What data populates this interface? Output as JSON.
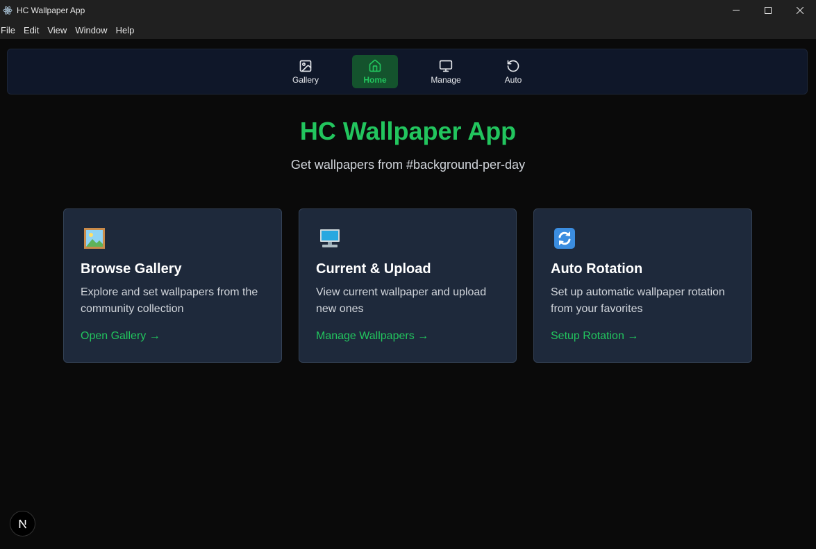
{
  "window": {
    "title": "HC Wallpaper App"
  },
  "menu": {
    "items": [
      "File",
      "Edit",
      "View",
      "Window",
      "Help"
    ]
  },
  "nav": {
    "items": [
      {
        "label": "Gallery",
        "icon": "image-icon",
        "active": false
      },
      {
        "label": "Home",
        "icon": "home-icon",
        "active": true
      },
      {
        "label": "Manage",
        "icon": "monitor-icon",
        "active": false
      },
      {
        "label": "Auto",
        "icon": "rotate-ccw-icon",
        "active": false
      }
    ]
  },
  "hero": {
    "title": "HC Wallpaper App",
    "subtitle": "Get wallpapers from #background-per-day"
  },
  "cards": [
    {
      "icon": "framed-picture-icon",
      "title": "Browse Gallery",
      "description": "Explore and set wallpapers from the community collection",
      "link": "Open Gallery →"
    },
    {
      "icon": "desktop-computer-icon",
      "title": "Current & Upload",
      "description": "View current wallpaper and upload new ones",
      "link": "Manage Wallpapers →"
    },
    {
      "icon": "arrows-clockwise-icon",
      "title": "Auto Rotation",
      "description": "Set up automatic wallpaper rotation from your favorites",
      "link": "Setup Rotation →"
    }
  ],
  "badge": {
    "letter": "N"
  },
  "colors": {
    "accent": "#22c55e",
    "active_bg": "#14532d",
    "card_bg": "#1e293b",
    "nav_bg": "#0f1729",
    "page_bg": "#0a0a0a"
  }
}
